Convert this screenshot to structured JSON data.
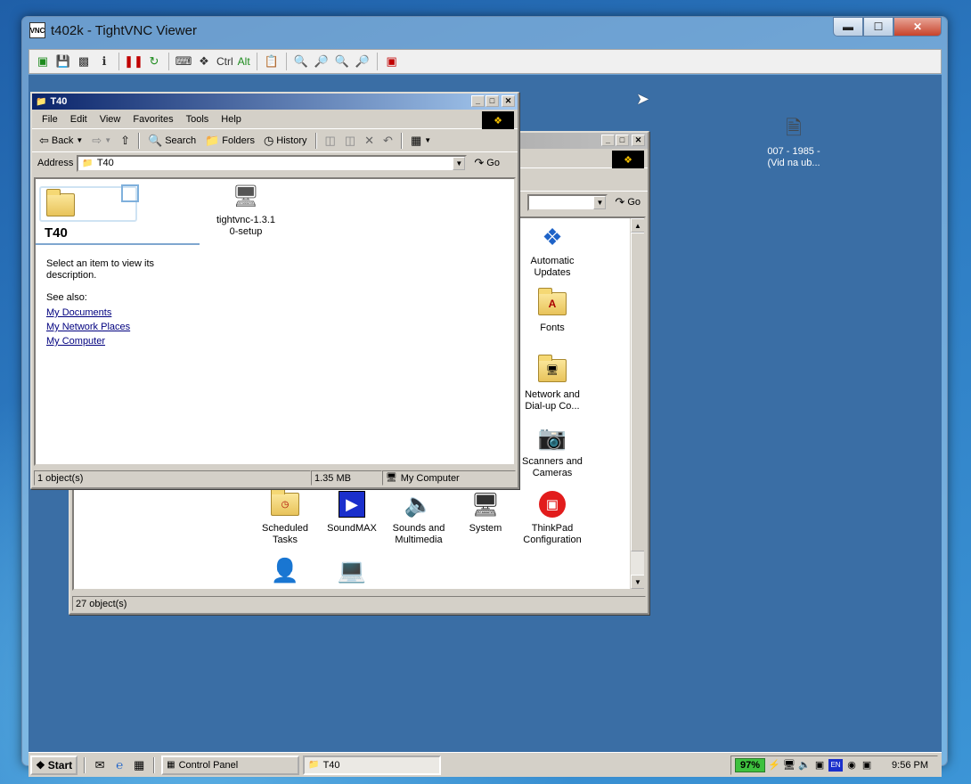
{
  "viewer": {
    "title": "t402k - TightVNC Viewer",
    "icon_text": "VNC",
    "toolbar": {
      "ctrl": "Ctrl",
      "alt": "Alt"
    }
  },
  "desktop_icon": {
    "label_line1": "007 - 1985 -",
    "label_line2": "(Vid na ub..."
  },
  "t40": {
    "title": "T40",
    "menu": [
      "File",
      "Edit",
      "View",
      "Favorites",
      "Tools",
      "Help"
    ],
    "toolbar": {
      "back": "Back",
      "search": "Search",
      "folders": "Folders",
      "history": "History"
    },
    "address_label": "Address",
    "address_value": "T40",
    "go": "Go",
    "folder_heading": "T40",
    "description": "Select an item to view its description.",
    "see_also": "See also:",
    "links": [
      "My Documents",
      "My Network Places",
      "My Computer"
    ],
    "file": {
      "line1": "tightvnc-1.3.1",
      "line2": "0-setup"
    },
    "status": {
      "objects": "1 object(s)",
      "size": "1.35 MB",
      "zone": "My Computer"
    }
  },
  "control_panel": {
    "go": "Go",
    "status": "27 object(s)",
    "icons": [
      {
        "line1": "Automatic",
        "line2": "Updates"
      },
      {
        "line1": "Fonts",
        "line2": ""
      },
      {
        "line1": "Network and",
        "line2": "Dial-up Co..."
      },
      {
        "line1": "Scanners and",
        "line2": "Cameras"
      },
      {
        "line1": "Scheduled",
        "line2": "Tasks"
      },
      {
        "line1": "SoundMAX",
        "line2": ""
      },
      {
        "line1": "Sounds and",
        "line2": "Multimedia"
      },
      {
        "line1": "System",
        "line2": ""
      },
      {
        "line1": "ThinkPad",
        "line2": "Configuration"
      }
    ]
  },
  "taskbar": {
    "start": "Start",
    "tasks": [
      "Control Panel",
      "T40"
    ],
    "battery": "97%",
    "lang": "EN",
    "clock": "9:56 PM"
  }
}
